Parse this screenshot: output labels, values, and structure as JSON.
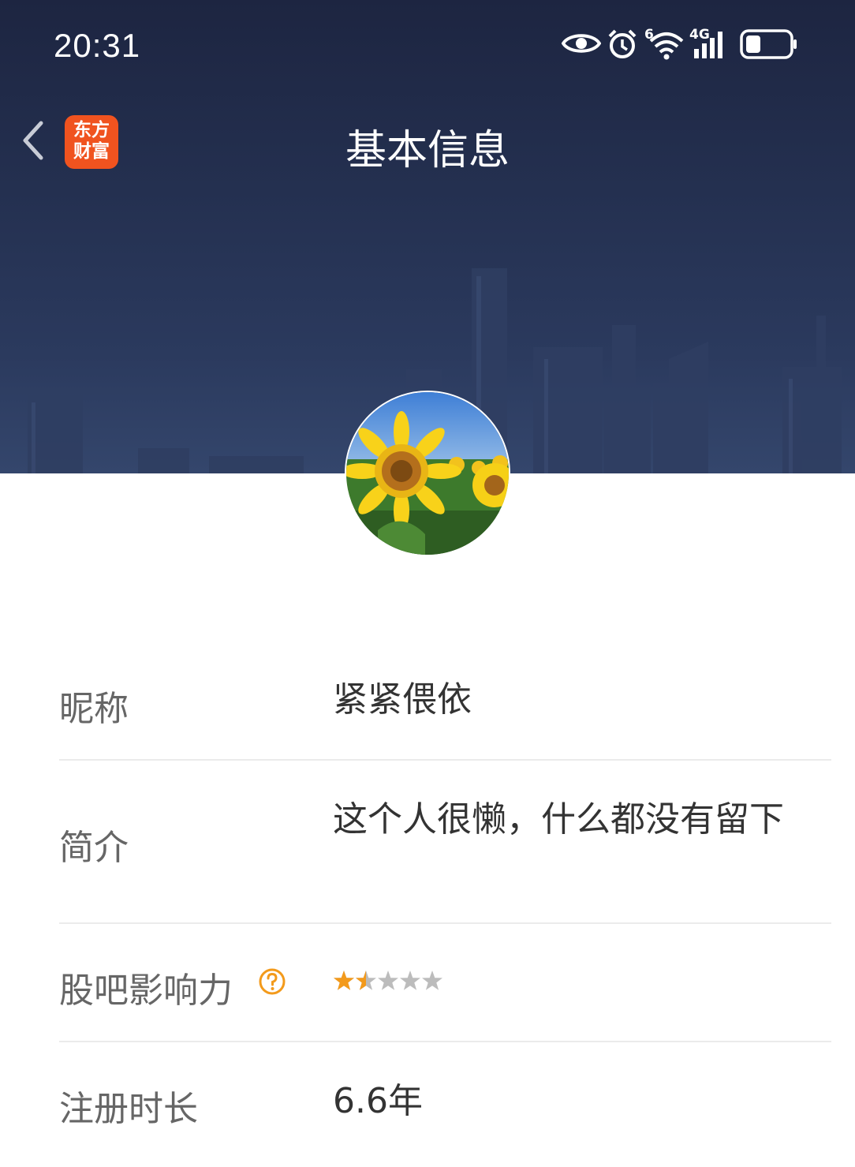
{
  "status_bar": {
    "time": "20:31",
    "icons": [
      "eye-icon",
      "alarm-icon",
      "wifi-icon",
      "signal-icon",
      "battery-icon"
    ],
    "wifi_badge": "6",
    "network_type": "4G"
  },
  "nav": {
    "back_icon": "chevron-left-icon",
    "app_logo_line1": "东方",
    "app_logo_line2": "财富",
    "title": "基本信息"
  },
  "avatar": {
    "subject": "sunflower"
  },
  "info": {
    "nickname": {
      "label": "昵称",
      "value": "紧紧偎依"
    },
    "intro": {
      "label": "简介",
      "value": "这个人很懒，什么都没有留下"
    },
    "influence": {
      "label": "股吧影响力",
      "help_icon": "question-circle-icon",
      "rating": 1.5,
      "max_rating": 5
    },
    "registration": {
      "label": "注册时长",
      "value": "6.6年"
    }
  },
  "colors": {
    "header_bg": "#1d2541",
    "logo_orange": "#f0531f",
    "star_filled": "#f39a1b",
    "star_empty": "#bcbcbc",
    "label_gray": "#666666",
    "value_dark": "#333333",
    "divider": "#ebebeb"
  }
}
